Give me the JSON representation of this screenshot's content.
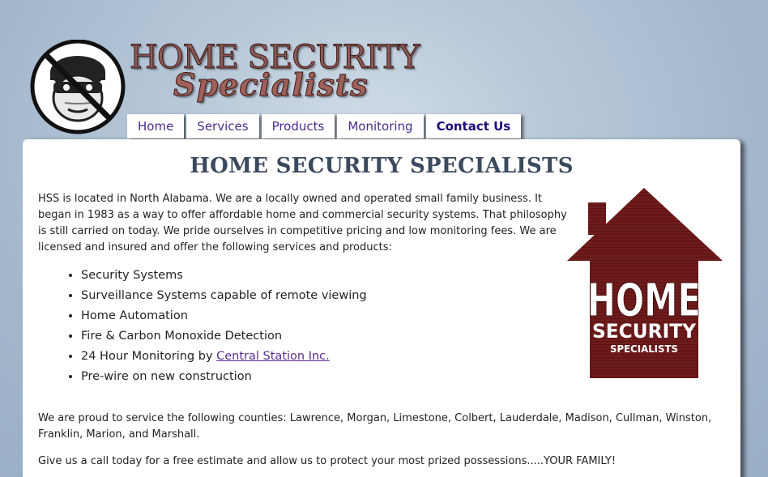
{
  "header": {
    "logo_line1": "HOME SECURITY",
    "logo_line2": "Specialists"
  },
  "nav": {
    "items": [
      {
        "label": "Home"
      },
      {
        "label": "Services"
      },
      {
        "label": "Products"
      },
      {
        "label": "Monitoring"
      },
      {
        "label": "Contact Us"
      }
    ],
    "active": "Contact Us"
  },
  "main": {
    "title": "HOME SECURITY SPECIALISTS",
    "intro": "HSS is located in North Alabama. We are a locally owned and operated small family business. It began in 1983 as a way to offer affordable home and commercial security systems. That philosophy is still carried on today. We pride ourselves in competitive pricing and low monitoring fees. We are licensed and insured and offer the following services and products:",
    "services": [
      {
        "text": "Security Systems"
      },
      {
        "text": "Surveillance Systems capable of remote viewing"
      },
      {
        "text": "Home Automation"
      },
      {
        "text": "Fire & Carbon Monoxide Detection"
      },
      {
        "text": "24 Hour Monitoring by ",
        "link": "Central Station Inc."
      },
      {
        "text": "Pre-wire on new construction"
      }
    ],
    "counties": "We are proud to service the following counties: Lawrence, Morgan, Limestone, Colbert, Lauderdale, Madison, Cullman, Winston, Franklin, Marion, and Marshall.",
    "closing": "Give us a call today for a free estimate and allow us to protect your most prized possessions.....YOUR FAMILY!"
  },
  "house_logo": {
    "line1": "HOME",
    "line2": "SECURITY",
    "line3": "SPECIALISTS"
  },
  "colors": {
    "accent": "#6e1b1b",
    "nav_text": "#4b2a8c",
    "title": "#3b4a5e"
  }
}
